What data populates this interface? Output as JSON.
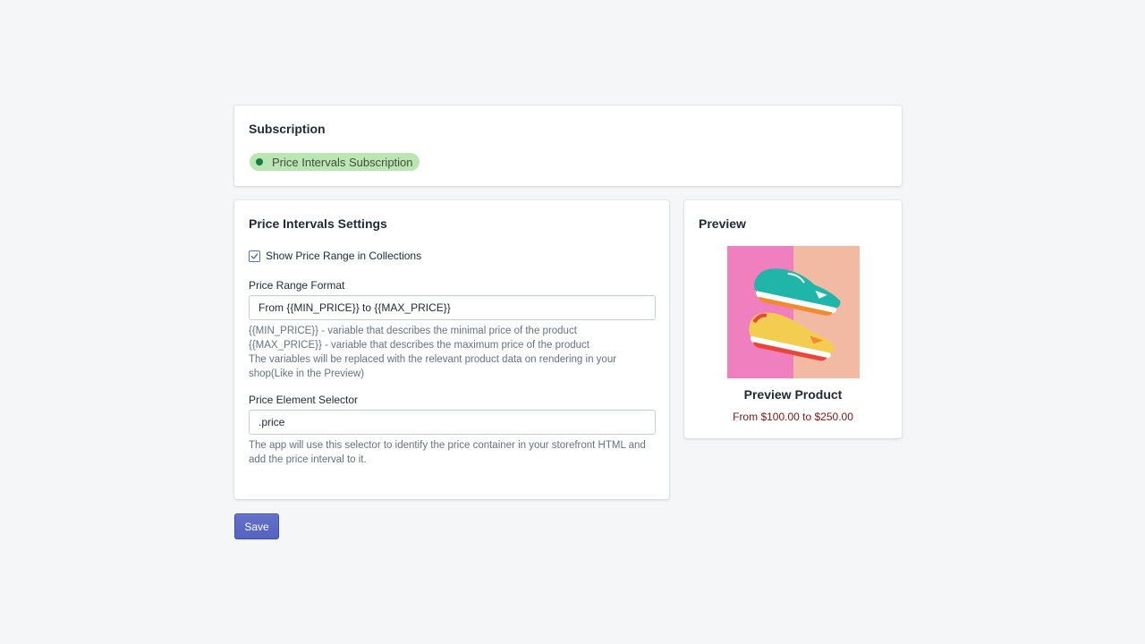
{
  "subscription": {
    "title": "Subscription",
    "badge_label": "Price Intervals Subscription",
    "badge_color": "#bbe5b3",
    "badge_dot_color": "#108043"
  },
  "settings": {
    "title": "Price Intervals Settings",
    "show_range_label": "Show Price Range in Collections",
    "show_range_checked": true,
    "format_label": "Price Range Format",
    "format_value": "From {{MIN_PRICE}} to {{MAX_PRICE}}",
    "format_help": [
      "{{MIN_PRICE}} - variable that describes the minimal price of the product",
      "{{MAX_PRICE}} - variable that describes the maximum price of the product",
      "The variables will be replaced with the relevant product data on rendering in your shop(Like in the Preview)"
    ],
    "selector_label": "Price Element Selector",
    "selector_value": ".price",
    "selector_help": "The app will use this selector to identify the price container in your storefront HTML and add the price interval to it."
  },
  "preview": {
    "title": "Preview",
    "product_name": "Preview Product",
    "product_price": "From $100.00 to $250.00",
    "price_color": "#7a1616"
  },
  "actions": {
    "save_label": "Save",
    "accent_color": "#5c6ac4"
  }
}
